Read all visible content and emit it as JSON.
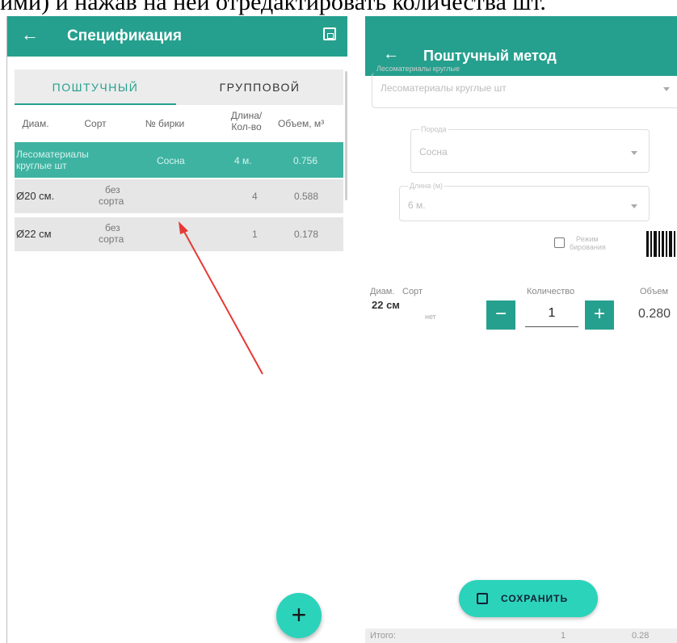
{
  "caption": "ими) и нажав на ней отредактировать количества шт.",
  "left": {
    "appbar": {
      "title": "Спецификация",
      "back_icon": "arrow-left-icon",
      "save_icon": "save-icon"
    },
    "tabs": [
      "ПОШТУЧНЫЙ",
      "ГРУППОВОЙ"
    ],
    "headers": {
      "diam": "Диам.",
      "sort": "Сорт",
      "tag": "№ бирки",
      "len1": "Длина/",
      "len2": "Кол-во",
      "vol": "Объем, м³"
    },
    "selected_row": {
      "name1": "Лесоматериалы",
      "name2": "круглые шт",
      "species": "Сосна",
      "length": "4 м.",
      "volume": "0.756"
    },
    "rows": [
      {
        "diam": "Ø20 см.",
        "sort1": "без",
        "sort2": "сорта",
        "count": "4",
        "volume": "0.588"
      },
      {
        "diam": "Ø22 см",
        "sort1": "без",
        "sort2": "сорта",
        "count": "1",
        "volume": "0.178"
      }
    ],
    "fab": "+"
  },
  "right": {
    "appbar": {
      "title": "Поштучный метод",
      "back_icon": "arrow-left-icon"
    },
    "fields": {
      "product_label": "Лесоматериалы круглые",
      "product": "Лесоматериалы круглые шт",
      "species_label": "Порода",
      "species": "Сосна",
      "length_label": "Длина (м)",
      "length": "6 м."
    },
    "checkbox": {
      "label1": "Режим",
      "label2": "бирования"
    },
    "headers": {
      "diam": "Диам.",
      "sort": "Сорт",
      "qty": "Количество",
      "vol": "Объем"
    },
    "item": {
      "diam": "22 см",
      "sort": "нет",
      "qty": "1",
      "minus": "−",
      "plus": "+",
      "volume": "0.280"
    },
    "save_label": "СОХРАНИТЬ",
    "footer": {
      "label": "Итого:",
      "qty": "1",
      "volume": "0.28"
    }
  },
  "colors": {
    "primary": "#26a08e",
    "accent": "#2bd3bb",
    "arrow": "#e53935"
  }
}
